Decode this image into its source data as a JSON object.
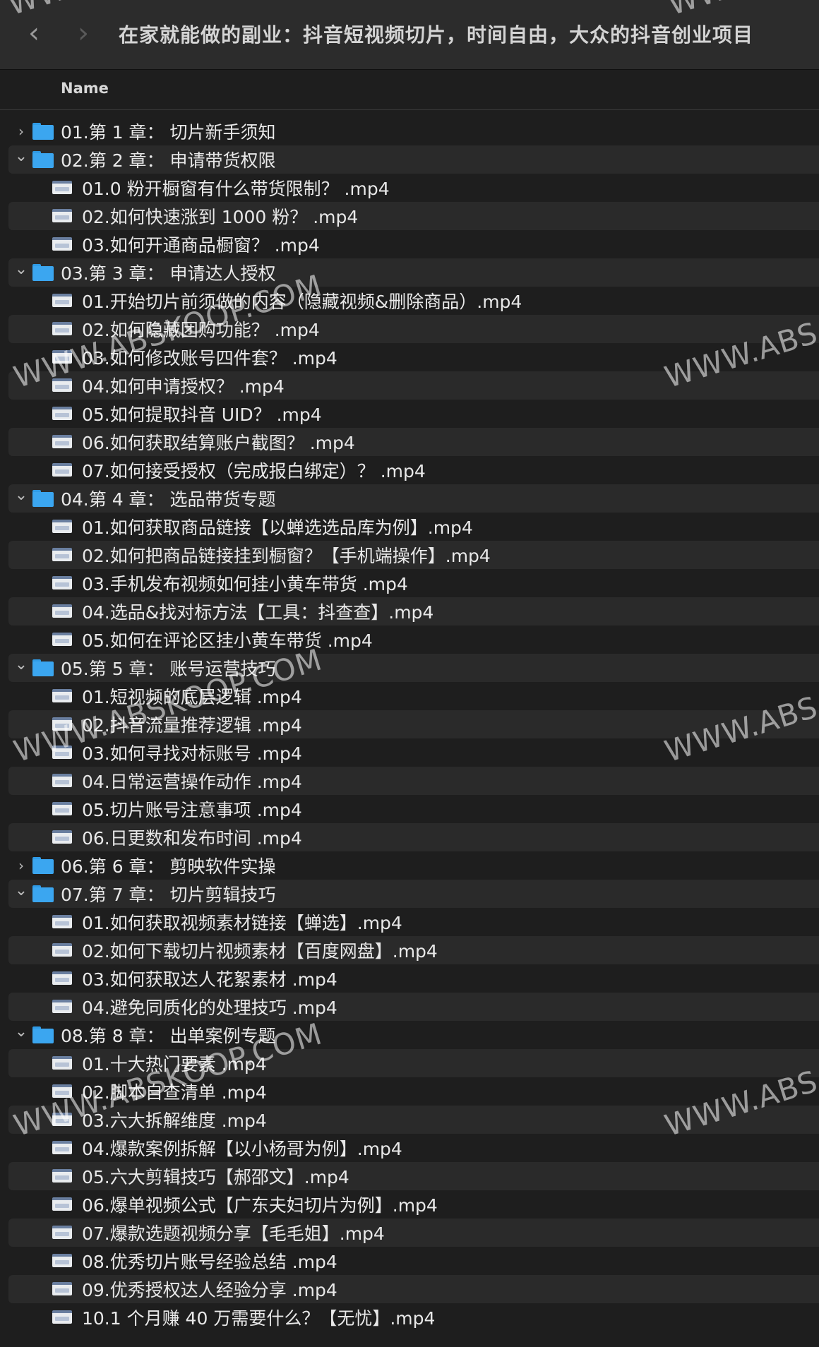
{
  "window": {
    "title": "在家就能做的副业：抖音短视频切片，时间自由，大众的抖音创业项目",
    "back_icon": "‹",
    "forward_icon": "›"
  },
  "column_header": {
    "name": "Name"
  },
  "rows": [
    {
      "type": "folder",
      "expanded": false,
      "label": "01.第 1 章：  切片新手须知"
    },
    {
      "type": "folder",
      "expanded": true,
      "label": "02.第 2 章：  申请带货权限"
    },
    {
      "type": "file",
      "label": "01.0 粉开橱窗有什么带货限制？  .mp4"
    },
    {
      "type": "file",
      "label": "02.如何快速涨到 1000 粉？  .mp4"
    },
    {
      "type": "file",
      "label": "03.如何开通商品橱窗？  .mp4"
    },
    {
      "type": "folder",
      "expanded": true,
      "label": "03.第 3 章：  申请达人授权"
    },
    {
      "type": "file",
      "label": "01.开始切片前须做的内容（隐藏视频&删除商品）.mp4"
    },
    {
      "type": "file",
      "label": "02.如何隐藏团购功能？  .mp4"
    },
    {
      "type": "file",
      "label": "03.如何修改账号四件套？  .mp4"
    },
    {
      "type": "file",
      "label": "04.如何申请授权？  .mp4"
    },
    {
      "type": "file",
      "label": "05.如何提取抖音 UID？  .mp4"
    },
    {
      "type": "file",
      "label": "06.如何获取结算账户截图？  .mp4"
    },
    {
      "type": "file",
      "label": "07.如何接受授权（完成报白绑定）？  .mp4"
    },
    {
      "type": "folder",
      "expanded": true,
      "label": "04.第 4 章：  选品带货专题"
    },
    {
      "type": "file",
      "label": "01.如何获取商品链接【以蝉选选品库为例】.mp4"
    },
    {
      "type": "file",
      "label": "02.如何把商品链接挂到橱窗？【手机端操作】.mp4"
    },
    {
      "type": "file",
      "label": "03.手机发布视频如何挂小黄车带货 .mp4"
    },
    {
      "type": "file",
      "label": "04.选品&找对标方法【工具：抖查查】.mp4"
    },
    {
      "type": "file",
      "label": "05.如何在评论区挂小黄车带货 .mp4"
    },
    {
      "type": "folder",
      "expanded": true,
      "label": "05.第 5 章：  账号运营技巧"
    },
    {
      "type": "file",
      "label": "01.短视频的底层逻辑 .mp4"
    },
    {
      "type": "file",
      "label": "02.抖音流量推荐逻辑 .mp4"
    },
    {
      "type": "file",
      "label": "03.如何寻找对标账号 .mp4"
    },
    {
      "type": "file",
      "label": "04.日常运营操作动作 .mp4"
    },
    {
      "type": "file",
      "label": "05.切片账号注意事项 .mp4"
    },
    {
      "type": "file",
      "label": "06.日更数和发布时间 .mp4"
    },
    {
      "type": "folder",
      "expanded": false,
      "label": "06.第 6 章：  剪映软件实操"
    },
    {
      "type": "folder",
      "expanded": true,
      "label": "07.第 7 章：  切片剪辑技巧"
    },
    {
      "type": "file",
      "label": "01.如何获取视频素材链接【蝉选】.mp4"
    },
    {
      "type": "file",
      "label": "02.如何下载切片视频素材【百度网盘】.mp4"
    },
    {
      "type": "file",
      "label": "03.如何获取达人花絮素材 .mp4"
    },
    {
      "type": "file",
      "label": "04.避免同质化的处理技巧 .mp4"
    },
    {
      "type": "folder",
      "expanded": true,
      "label": "08.第 8 章：  出单案例专题"
    },
    {
      "type": "file",
      "label": "01.十大热门要素 .mp4"
    },
    {
      "type": "file",
      "label": "02.脚本自查清单 .mp4"
    },
    {
      "type": "file",
      "label": "03.六大拆解维度 .mp4"
    },
    {
      "type": "file",
      "label": "04.爆款案例拆解【以小杨哥为例】.mp4"
    },
    {
      "type": "file",
      "label": "05.六大剪辑技巧【郝邵文】.mp4"
    },
    {
      "type": "file",
      "label": "06.爆单视频公式【广东夫妇切片为例】.mp4"
    },
    {
      "type": "file",
      "label": "07.爆款选题视频分享【毛毛姐】.mp4"
    },
    {
      "type": "file",
      "label": "08.优秀切片账号经验总结 .mp4"
    },
    {
      "type": "file",
      "label": "09.优秀授权达人经验分享 .mp4"
    },
    {
      "type": "file",
      "label": "10.1 个月赚 40 万需要什么？【无忧】.mp4"
    }
  ],
  "watermarks": [
    "WWW.ABSKOOP.COM",
    "WWW.ABS",
    "WWW.ABSKOOP.COM",
    "WWW.ABS",
    "WWW.ABSKOOP.COM",
    "WWW.ABS",
    "WWW",
    "WWW"
  ]
}
